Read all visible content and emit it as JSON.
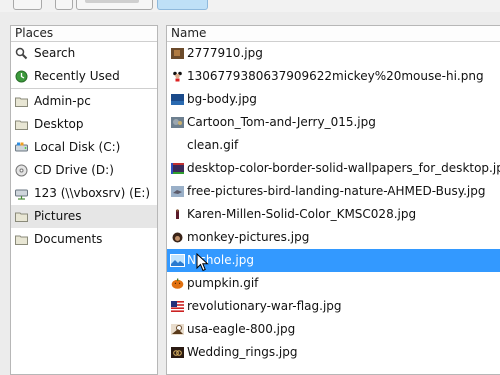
{
  "places": {
    "header": "Places",
    "items": [
      {
        "label": "Search",
        "icon": "search-icon"
      },
      {
        "label": "Recently Used",
        "icon": "clock-icon"
      },
      {
        "label": "Admin-pc",
        "icon": "folder-icon"
      },
      {
        "label": "Desktop",
        "icon": "folder-icon"
      },
      {
        "label": "Local Disk (C:)",
        "icon": "harddisk-icon"
      },
      {
        "label": "CD Drive (D:)",
        "icon": "cd-drive-icon"
      },
      {
        "label": "123 (\\\\vboxsrv) (E:)",
        "icon": "network-drive-icon"
      },
      {
        "label": "Pictures",
        "icon": "folder-icon",
        "selected": true
      },
      {
        "label": "Documents",
        "icon": "folder-icon"
      }
    ]
  },
  "files": {
    "header": "Name",
    "rows": [
      {
        "name": "2777910.jpg",
        "icon": "image-thumbnail-icon"
      },
      {
        "name": "1306779380637909622mickey%20mouse-hi.png",
        "icon": "image-thumbnail-icon"
      },
      {
        "name": "bg-body.jpg",
        "icon": "image-thumbnail-icon"
      },
      {
        "name": "Cartoon_Tom-and-Jerry_015.jpg",
        "icon": "image-thumbnail-icon"
      },
      {
        "name": "clean.gif",
        "icon": "blank-file-icon"
      },
      {
        "name": "desktop-color-border-solid-wallpapers_for_desktop.jpg",
        "icon": "image-thumbnail-icon"
      },
      {
        "name": "free-pictures-bird-landing-nature-AHMED-Busy.jpg",
        "icon": "image-thumbnail-icon"
      },
      {
        "name": "Karen-Millen-Solid-Color_KMSC028.jpg",
        "icon": "image-thumbnail-icon"
      },
      {
        "name": "monkey-pictures.jpg",
        "icon": "image-thumbnail-icon"
      },
      {
        "name": "Nichole.jpg",
        "icon": "image-thumbnail-icon",
        "selected": true
      },
      {
        "name": "pumpkin.gif",
        "icon": "image-thumbnail-icon"
      },
      {
        "name": "revolutionary-war-flag.jpg",
        "icon": "image-thumbnail-icon"
      },
      {
        "name": "usa-eagle-800.jpg",
        "icon": "image-thumbnail-icon"
      },
      {
        "name": "Wedding_rings.jpg",
        "icon": "image-thumbnail-icon"
      }
    ]
  },
  "colors": {
    "selection": "#3399ff",
    "places_selected": "#e6e6e6",
    "toolbar_active": "#bfe0f7"
  }
}
